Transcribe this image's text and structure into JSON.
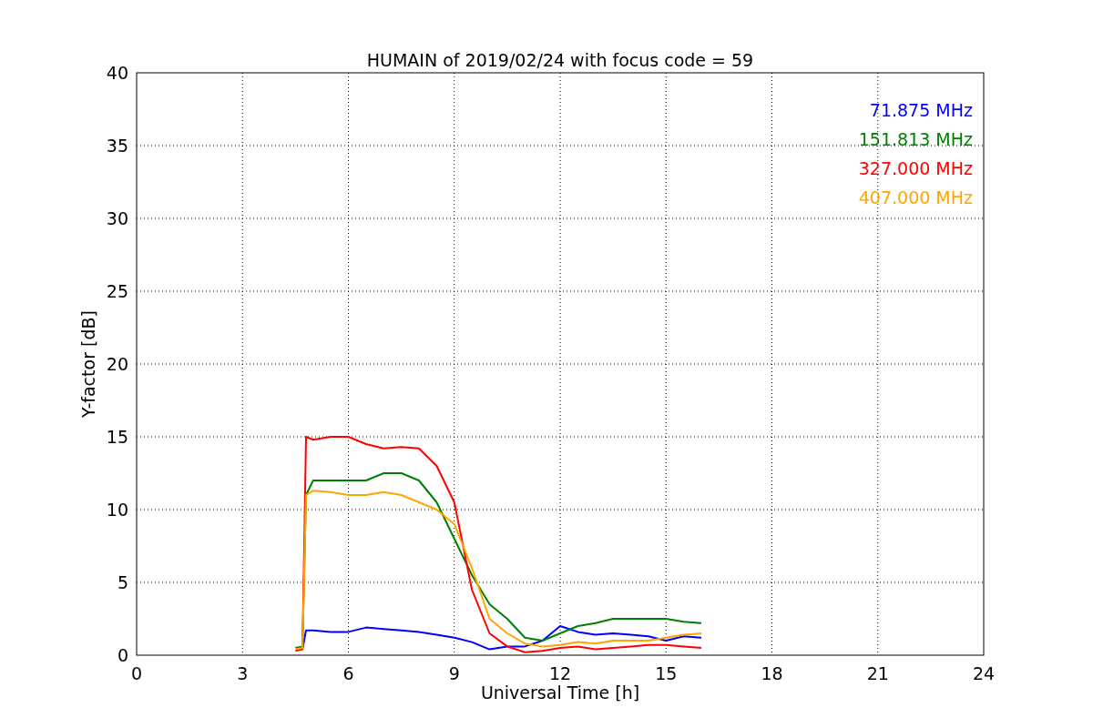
{
  "chart_data": {
    "type": "line",
    "title": "HUMAIN of 2019/02/24 with focus code = 59",
    "xlabel": "Universal Time [h]",
    "ylabel": "Y-factor [dB]",
    "x": [
      4.5,
      4.7,
      4.8,
      5,
      5.5,
      6,
      6.5,
      7,
      7.5,
      8,
      8.5,
      9,
      9.5,
      10,
      10.5,
      11,
      11.5,
      12,
      12.5,
      13,
      13.5,
      14,
      14.5,
      15,
      15.5,
      16
    ],
    "series": [
      {
        "name": "71.875 MHz",
        "color": "#0000ff",
        "values": [
          null,
          0.4,
          1.7,
          1.7,
          1.6,
          1.6,
          1.9,
          1.8,
          1.7,
          1.6,
          1.4,
          1.2,
          0.9,
          0.4,
          0.6,
          0.6,
          1.0,
          2.0,
          1.6,
          1.4,
          1.5,
          1.4,
          1.3,
          1.0,
          1.3,
          1.2
        ]
      },
      {
        "name": "151.813 MHz",
        "color": "#008000",
        "values": [
          0.5,
          0.6,
          11,
          12,
          12,
          12,
          12,
          12.5,
          12.5,
          12,
          10.5,
          8,
          5.5,
          3.5,
          2.5,
          1.2,
          1.0,
          1.5,
          2.0,
          2.2,
          2.5,
          2.5,
          2.5,
          2.5,
          2.3,
          2.2
        ]
      },
      {
        "name": "327.000 MHz",
        "color": "#ff0000",
        "values": [
          0.3,
          0.4,
          15,
          14.8,
          15,
          15,
          14.5,
          14.2,
          14.3,
          14.2,
          13,
          10.5,
          4.5,
          1.5,
          0.6,
          0.2,
          0.3,
          0.5,
          0.6,
          0.4,
          0.5,
          0.6,
          0.7,
          0.7,
          0.6,
          0.5
        ]
      },
      {
        "name": "407.000 MHz",
        "color": "#ffa500",
        "values": [
          0.4,
          0.5,
          11,
          11.3,
          11.2,
          11,
          11,
          11.2,
          11,
          10.5,
          10,
          9,
          6,
          2.5,
          1.5,
          0.8,
          0.6,
          0.7,
          0.9,
          0.8,
          1,
          1,
          1,
          1.2,
          1.4,
          1.5
        ]
      }
    ],
    "xlim": [
      0,
      24
    ],
    "ylim": [
      0,
      40
    ],
    "xticks": [
      0,
      3,
      6,
      9,
      12,
      15,
      18,
      21,
      24
    ],
    "yticks": [
      0,
      5,
      10,
      15,
      20,
      25,
      30,
      35,
      40
    ],
    "grid": true
  }
}
